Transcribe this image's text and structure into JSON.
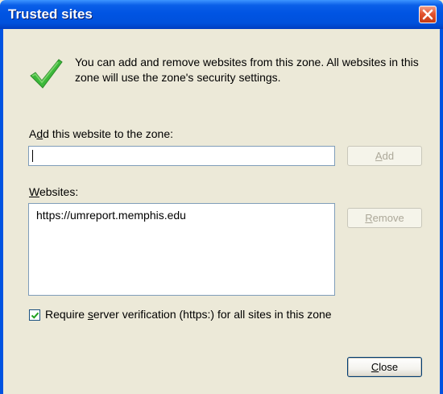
{
  "window": {
    "title": "Trusted sites"
  },
  "intro": {
    "text": "You can add and remove websites from this zone. All websites in this zone will use the zone's security settings."
  },
  "add": {
    "label_pre": "A",
    "label_key": "d",
    "label_post": "d this website to the zone:",
    "value": "",
    "button_key": "A",
    "button_rest": "dd"
  },
  "websites": {
    "label_key": "W",
    "label_post": "ebsites:",
    "items": [
      "https://umreport.memphis.edu"
    ],
    "remove_key": "R",
    "remove_rest": "emove"
  },
  "verification": {
    "checked": true,
    "label_pre": "Require ",
    "label_key": "s",
    "label_post": "erver verification (https:) for all sites in this zone"
  },
  "close": {
    "key": "C",
    "rest": "lose"
  },
  "colors": {
    "title_bar": "#0054e3",
    "dialog_bg": "#ece9d8",
    "check_green": "#3cb83a",
    "close_red": "#e3542f"
  }
}
